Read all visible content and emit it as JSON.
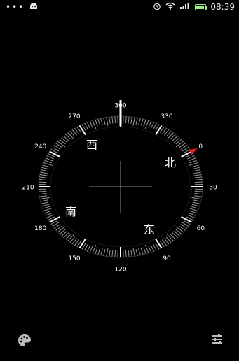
{
  "status_bar": {
    "left_icons": [
      "more-dots-icon",
      "android-icon"
    ],
    "right_icons": [
      "alarm-icon",
      "wifi-icon",
      "signal-icon",
      "battery-icon"
    ],
    "dots": "•••",
    "time": "08:39"
  },
  "compass": {
    "tick_labels": [
      "300",
      "330",
      "0",
      "30",
      "60",
      "90",
      "120",
      "150",
      "180",
      "210",
      "240",
      "270"
    ],
    "cardinals": {
      "north": "北",
      "east": "东",
      "south": "南",
      "west": "西"
    },
    "needle_color": "#e01e1e",
    "heading_deg": 300
  },
  "bottom_bar": {
    "left_icon": "palette-icon",
    "right_icon": "sliders-icon"
  }
}
